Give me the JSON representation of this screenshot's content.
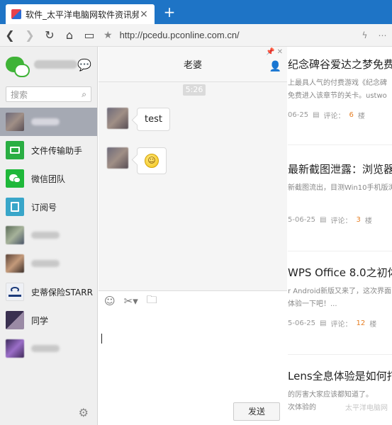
{
  "browser": {
    "tab_title": "软件_太平洋电脑网软件资讯频道",
    "tab_close": "×",
    "new_tab": "+",
    "url": "http://pcedu.pconline.com.cn/"
  },
  "wechat": {
    "search_placeholder": "搜索",
    "contacts": [
      {
        "name": "",
        "blurred": true,
        "avatar_color": "#8b8b99",
        "active": true
      },
      {
        "name": "文件传输助手",
        "avatar_color": "#2aae43"
      },
      {
        "name": "微信团队",
        "avatar_color": "#1fb83a"
      },
      {
        "name": "订阅号",
        "avatar_color": "#39a6c9"
      },
      {
        "name": "",
        "blurred": true,
        "avatar_color": "#7a8f73"
      },
      {
        "name": "",
        "blurred": true,
        "avatar_color": "#6b5548"
      },
      {
        "name": "史蒂保险STARR",
        "avatar_color": "#e9e9ef"
      },
      {
        "name": "同学",
        "avatar_color": "#6a5a7a"
      },
      {
        "name": "",
        "blurred": true,
        "avatar_color": "#6b4a87"
      }
    ],
    "chat": {
      "title": "老婆",
      "timestamp": "5:26",
      "messages": [
        {
          "type": "text",
          "text": "test"
        },
        {
          "type": "emoji",
          "text": "☺"
        }
      ],
      "send_label": "发送"
    }
  },
  "articles": [
    {
      "title": "纪念碑谷爱达之梦免费",
      "desc": "上最具人气的付费游戏《纪念碑",
      "desc2": "免费进入该章节的关卡。ustwo",
      "date": "06-25",
      "comment_label": "评论：",
      "count": "6",
      "floor": "楼"
    },
    {
      "title": "最新截图泄露：浏览器",
      "desc": "新截图流出，目测Win10手机版浏",
      "desc2": "",
      "date": "5-06-25",
      "comment_label": "评论：",
      "count": "3",
      "floor": "楼"
    },
    {
      "title": "WPS Office 8.0之初体",
      "desc": "r Android新版又来了，这次界面",
      "desc2": "体验一下吧！...",
      "date": "5-06-25",
      "comment_label": "评论：",
      "count": "12",
      "floor": "楼"
    },
    {
      "title": "Lens全息体验是如何打",
      "desc": "的厉害大家应该都知道了。",
      "desc2": "次体验的",
      "date": "",
      "comment_label": "",
      "count": "",
      "floor": ""
    }
  ],
  "watermark": "太平洋电脑网"
}
